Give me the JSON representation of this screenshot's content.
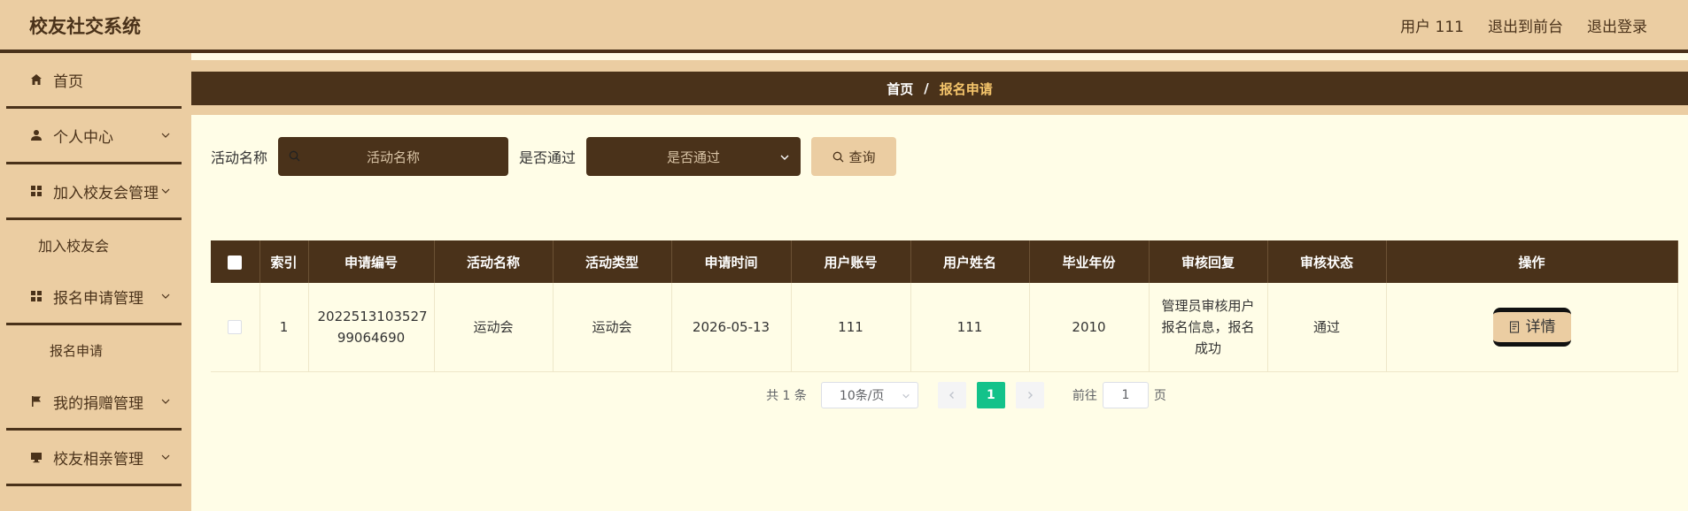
{
  "header": {
    "title": "校友社交系统",
    "links": [
      "用户 111",
      "退出到前台",
      "退出登录"
    ]
  },
  "sidebar": {
    "items": [
      {
        "label": "首页",
        "icon": "home-icon"
      },
      {
        "label": "个人中心",
        "icon": "user-icon"
      },
      {
        "label": "加入校友会管理",
        "icon": "grid-icon"
      },
      {
        "label": "报名申请管理",
        "icon": "grid-icon"
      },
      {
        "label": "我的捐赠管理",
        "icon": "flag-icon"
      },
      {
        "label": "校友相亲管理",
        "icon": "monitor-icon"
      }
    ],
    "subitems": {
      "join": "加入校友会",
      "signup": "报名申请"
    }
  },
  "breadcrumb": {
    "home": "首页",
    "separator": "/",
    "current": "报名申请"
  },
  "search": {
    "name_label": "活动名称",
    "name_placeholder": "活动名称",
    "pass_label": "是否通过",
    "pass_placeholder": "是否通过",
    "query_button": "查询"
  },
  "table": {
    "headers": [
      "索引",
      "申请编号",
      "活动名称",
      "活动类型",
      "申请时间",
      "用户账号",
      "用户姓名",
      "毕业年份",
      "审核回复",
      "审核状态",
      "操作"
    ],
    "rows": [
      {
        "index": "1",
        "apply_no": "2022513103527 99064690",
        "activity_name": "运动会",
        "activity_type": "运动会",
        "apply_time": "2026-05-13",
        "account": "111",
        "name": "111",
        "grad_year": "2010",
        "reply": "管理员审核用户报名信息，报名成功",
        "status": "通过",
        "action": "详情"
      }
    ]
  },
  "pagination": {
    "total": "共 1 条",
    "page_size": "10条/页",
    "current_page": "1",
    "goto_label": "前往",
    "goto_value": "1",
    "page_suffix": "页"
  },
  "colors": {
    "header_bg": "#ebcda2",
    "dark": "#4a321a",
    "content_bg": "#fffde7",
    "active_page": "#13c28a",
    "breadcrumb_current": "#f5c56b"
  }
}
